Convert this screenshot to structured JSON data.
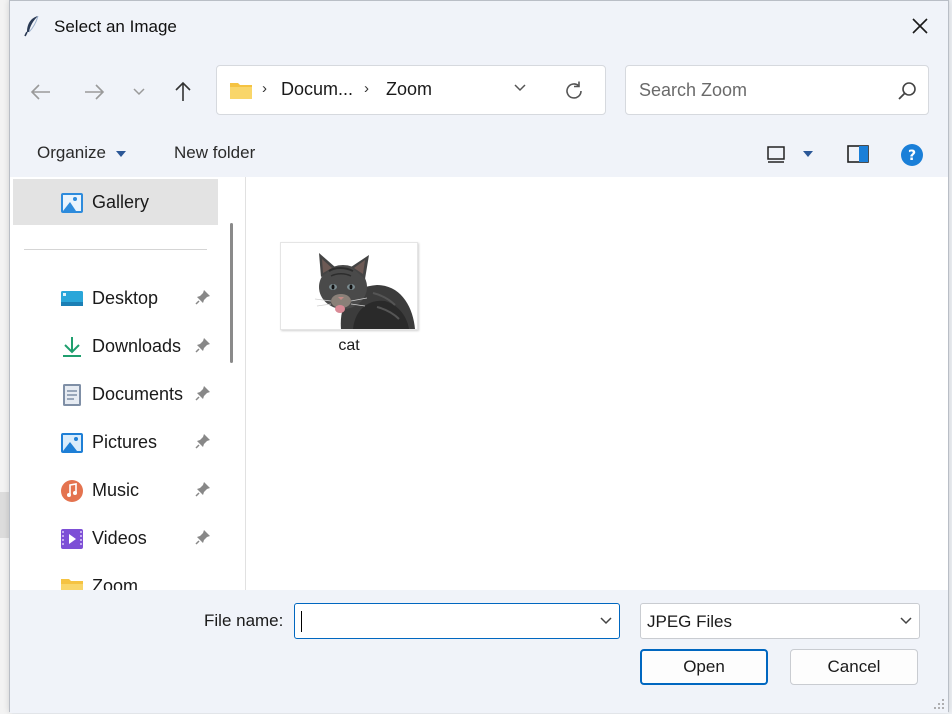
{
  "window": {
    "title": "Select an Image"
  },
  "address_bar": {
    "breadcrumbs": [
      "Docum...",
      "Zoom"
    ]
  },
  "search": {
    "placeholder": "Search Zoom"
  },
  "toolbar": {
    "organize_label": "Organize",
    "new_folder_label": "New folder"
  },
  "sidebar": {
    "items": [
      {
        "label": "Gallery",
        "icon": "gallery-icon",
        "pinned": false,
        "selected": true
      },
      {
        "label": "Desktop",
        "icon": "desktop-icon",
        "pinned": true
      },
      {
        "label": "Downloads",
        "icon": "downloads-icon",
        "pinned": true
      },
      {
        "label": "Documents",
        "icon": "documents-icon",
        "pinned": true
      },
      {
        "label": "Pictures",
        "icon": "pictures-icon",
        "pinned": true
      },
      {
        "label": "Music",
        "icon": "music-icon",
        "pinned": true
      },
      {
        "label": "Videos",
        "icon": "videos-icon",
        "pinned": true
      },
      {
        "label": "Zoom",
        "icon": "folder-icon",
        "pinned": false
      }
    ]
  },
  "files": [
    {
      "name": "cat",
      "thumbnail": "cat-thumbnail"
    }
  ],
  "footer": {
    "file_name_label": "File name:",
    "file_name_value": "",
    "file_type": "JPEG Files",
    "open_label": "Open",
    "cancel_label": "Cancel"
  },
  "colors": {
    "accent": "#0067c0",
    "chrome": "#f0f3f9",
    "selection": "#e3e3e3",
    "folder": "#f5c342",
    "help": "#1a7fd8"
  }
}
